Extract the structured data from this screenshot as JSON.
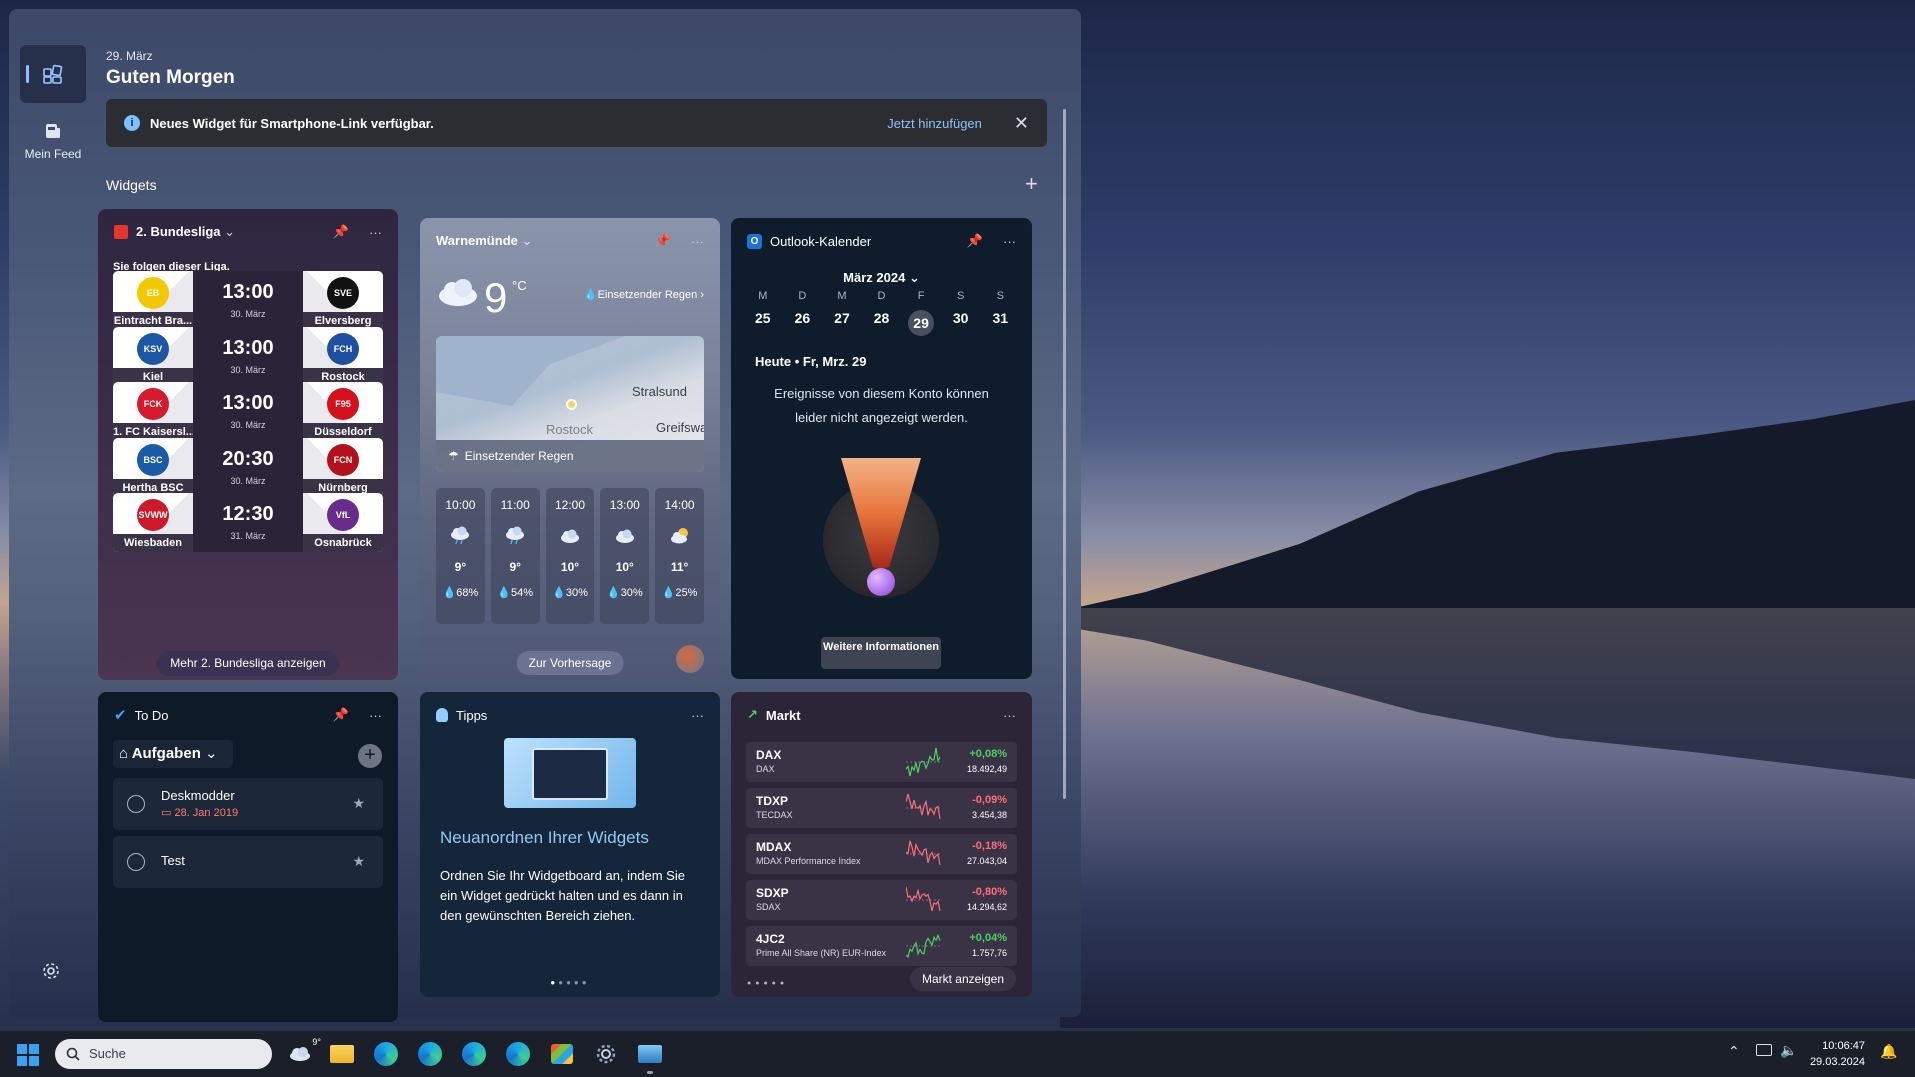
{
  "header": {
    "date": "29. März",
    "greeting": "Guten Morgen"
  },
  "sidebar": {
    "feed_label": "Mein Feed"
  },
  "notice": {
    "message": "Neues Widget für Smartphone-Link verfügbar.",
    "action": "Jetzt hinzufügen"
  },
  "widgets_label": "Widgets",
  "bundesliga": {
    "title": "2. Bundesliga",
    "subtitle": "Sie folgen dieser Liga.",
    "matches": [
      {
        "home": "Eintracht Bra...",
        "home_short": "EB",
        "home_color": "#f4c800",
        "away": "Elversberg",
        "away_short": "SVE",
        "away_color": "#111111",
        "time": "13:00",
        "date": "30. März"
      },
      {
        "home": "Kiel",
        "home_short": "KSV",
        "home_color": "#1e56a6",
        "away": "Rostock",
        "away_short": "FCH",
        "away_color": "#1f4fa0",
        "time": "13:00",
        "date": "30. März"
      },
      {
        "home": "1. FC Kaisersl...",
        "home_short": "FCK",
        "home_color": "#d51a2b",
        "away": "Düsseldorf",
        "away_short": "F95",
        "away_color": "#d5111b",
        "time": "13:00",
        "date": "30. März"
      },
      {
        "home": "Hertha BSC",
        "home_short": "BSC",
        "home_color": "#1a5ba8",
        "away": "Nürnberg",
        "away_short": "FCN",
        "away_color": "#b3121d",
        "time": "20:30",
        "date": "30. März"
      },
      {
        "home": "Wiesbaden",
        "home_short": "SVWW",
        "home_color": "#cc1a28",
        "away": "Osnabrück",
        "away_short": "VfL",
        "away_color": "#6a2c8c",
        "time": "12:30",
        "date": "31. März"
      }
    ],
    "more": "Mehr 2. Bundesliga anzeigen"
  },
  "weather": {
    "title": "Warnemünde",
    "temp": "9",
    "unit": "°C",
    "condition": "Einsetzender Regen",
    "map": {
      "labels": [
        "Stralsund",
        "Rostock",
        "Greifswa"
      ],
      "caption": "Einsetzender Regen"
    },
    "hours": [
      {
        "time": "10:00",
        "temp": "9°",
        "precip": "68%",
        "icon": "rain-cloud"
      },
      {
        "time": "11:00",
        "temp": "9°",
        "precip": "54%",
        "icon": "rain-cloud"
      },
      {
        "time": "12:00",
        "temp": "10°",
        "precip": "30%",
        "icon": "cloud"
      },
      {
        "time": "13:00",
        "temp": "10°",
        "precip": "30%",
        "icon": "cloud"
      },
      {
        "time": "14:00",
        "temp": "11°",
        "precip": "25%",
        "icon": "sun-cloud"
      }
    ],
    "forecast": "Zur Vorhersage"
  },
  "calendar": {
    "title": "Outlook-Kalender",
    "month": "März 2024",
    "weekdays": [
      "M",
      "D",
      "M",
      "D",
      "F",
      "S",
      "S"
    ],
    "days": [
      "25",
      "26",
      "27",
      "28",
      "29",
      "30",
      "31"
    ],
    "today": "Heute • Fr, Mrz. 29",
    "note": "Ereignisse von diesem Konto können leider nicht angezeigt werden.",
    "button": "Weitere Informationen"
  },
  "todo": {
    "title": "To Do",
    "list": "Aufgaben",
    "tasks": [
      {
        "name": "Deskmodder",
        "due": "28. Jan 2019"
      },
      {
        "name": "Test",
        "due": ""
      }
    ]
  },
  "tips": {
    "title": "Tipps",
    "heading": "Neuanordnen Ihrer Widgets",
    "body": "Ordnen Sie Ihr Widgetboard an, indem Sie ein Widget gedrückt halten und es dann in den gewünschten Bereich ziehen."
  },
  "market": {
    "title": "Markt",
    "stocks": [
      {
        "symbol": "DAX",
        "name": "DAX",
        "change": "+0,08%",
        "price": "18.492,49",
        "trend": "up",
        "color": "#4cd263"
      },
      {
        "symbol": "TDXP",
        "name": "TECDAX",
        "change": "-0,09%",
        "price": "3.454,38",
        "trend": "down",
        "color": "#ff6f7a"
      },
      {
        "symbol": "MDAX",
        "name": "MDAX Performance Index",
        "change": "-0,18%",
        "price": "27.043,04",
        "trend": "down",
        "color": "#ff6f7a"
      },
      {
        "symbol": "SDXP",
        "name": "SDAX",
        "change": "-0,80%",
        "price": "14.294,62",
        "trend": "down",
        "color": "#ff6f7a"
      },
      {
        "symbol": "4JC2",
        "name": "Prime All Share (NR) EUR-Index",
        "change": "+0,04%",
        "price": "1.757,76",
        "trend": "up",
        "color": "#4cd263"
      }
    ],
    "button": "Markt anzeigen"
  },
  "taskbar": {
    "search_placeholder": "Suche",
    "weather_temp": "9°",
    "time": "10:06:47",
    "date": "29.03.2024"
  }
}
